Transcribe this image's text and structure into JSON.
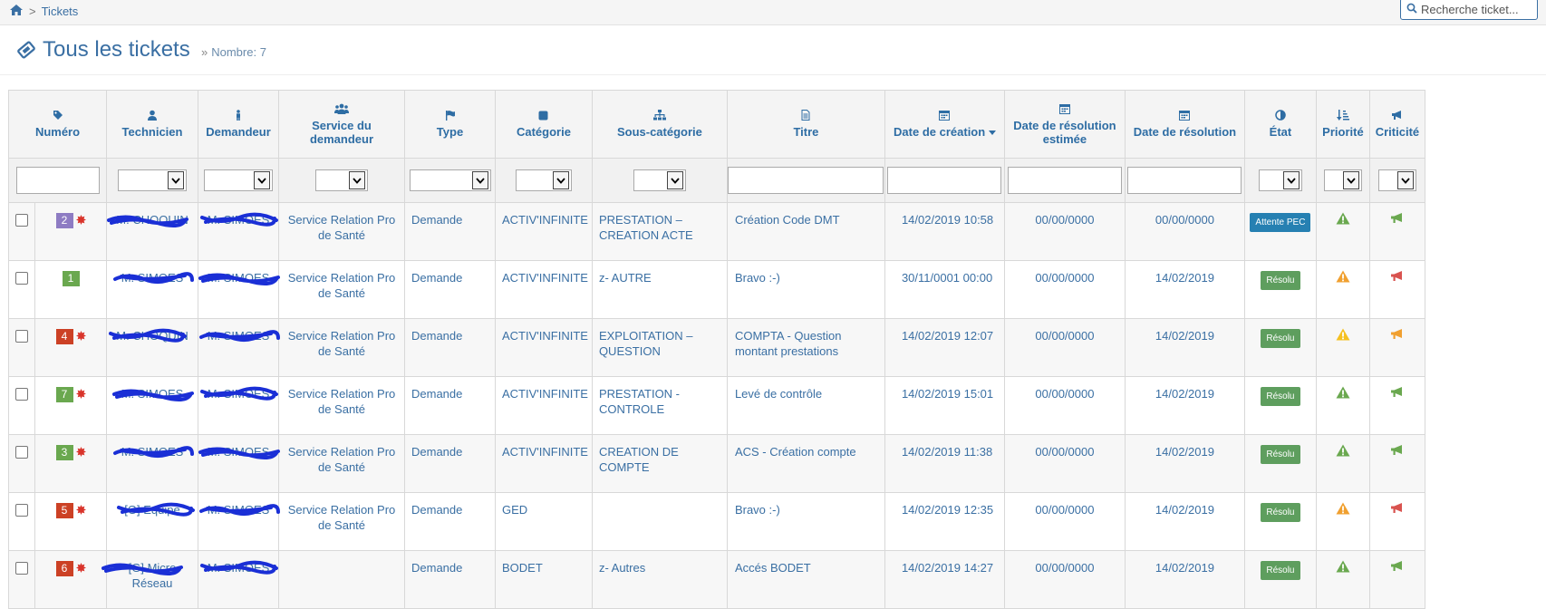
{
  "breadcrumb": {
    "home_icon": "home-icon",
    "separator": ">",
    "current": "Tickets"
  },
  "search": {
    "placeholder": "Recherche ticket...",
    "value": ""
  },
  "page": {
    "title": "Tous les tickets",
    "count_label": "Nombre: 7"
  },
  "columns": {
    "numero": "Numéro",
    "technicien": "Technicien",
    "demandeur": "Demandeur",
    "service": "Service du demandeur",
    "type": "Type",
    "categorie": "Catégorie",
    "sous_categorie": "Sous-catégorie",
    "titre": "Titre",
    "date_creation": "Date de création",
    "date_resolution_estimee": "Date de résolution estimée",
    "date_resolution": "Date de résolution",
    "etat": "État",
    "priorite": "Priorité",
    "criticite": "Criticité"
  },
  "colors": {
    "accent": "#3a6fa3",
    "purple": "#8e7cc3",
    "green": "#6aa84f",
    "red": "#cc4125",
    "warn_green": "#6aa84f",
    "warn_orange": "#f0a030",
    "warn_yellow": "#f5c020",
    "crit_red": "#d9534f",
    "crit_orange": "#f0a030"
  },
  "rows": [
    {
      "num": "2",
      "num_color": "purple",
      "star": true,
      "technicien": "M. CHOQUIN",
      "demandeur": "M. SIMOES",
      "service": "Service Relation Pro de Santé",
      "type": "Demande",
      "categorie": "ACTIV'INFINITE",
      "sous_categorie": "PRESTATION – CREATION ACTE",
      "titre": "Création Code DMT",
      "date_creation": "14/02/2019 10:58",
      "date_res_est": "00/00/0000",
      "date_res": "00/00/0000",
      "etat": "Attente PEC",
      "etat_kind": "wait",
      "priorite": "green",
      "criticite": "green"
    },
    {
      "num": "1",
      "num_color": "green",
      "star": false,
      "technicien": "M. SIMOES",
      "demandeur": "M. SIMOES",
      "service": "Service Relation Pro de Santé",
      "type": "Demande",
      "categorie": "ACTIV'INFINITE",
      "sous_categorie": "z- AUTRE",
      "titre": "Bravo :-)",
      "date_creation": "30/11/0001 00:00",
      "date_res_est": "00/00/0000",
      "date_res": "14/02/2019",
      "etat": "Résolu",
      "etat_kind": "ok",
      "priorite": "orange",
      "criticite": "red"
    },
    {
      "num": "4",
      "num_color": "red",
      "star": true,
      "technicien": "M. CHOQUIN",
      "demandeur": "M. SIMOES",
      "service": "Service Relation Pro de Santé",
      "type": "Demande",
      "categorie": "ACTIV'INFINITE",
      "sous_categorie": "EXPLOITATION – QUESTION",
      "titre": "COMPTA - Question montant prestations",
      "date_creation": "14/02/2019 12:07",
      "date_res_est": "00/00/0000",
      "date_res": "14/02/2019",
      "etat": "Résolu",
      "etat_kind": "ok",
      "priorite": "yellow",
      "criticite": "orange"
    },
    {
      "num": "7",
      "num_color": "green",
      "star": true,
      "technicien": "M. SIMOES",
      "demandeur": "M. SIMOES",
      "service": "Service Relation Pro de Santé",
      "type": "Demande",
      "categorie": "ACTIV'INFINITE",
      "sous_categorie": "PRESTATION - CONTROLE",
      "titre": "Levé de contrôle",
      "date_creation": "14/02/2019 15:01",
      "date_res_est": "00/00/0000",
      "date_res": "14/02/2019",
      "etat": "Résolu",
      "etat_kind": "ok",
      "priorite": "green",
      "criticite": "green"
    },
    {
      "num": "3",
      "num_color": "green",
      "star": true,
      "technicien": "M. SIMOES",
      "demandeur": "M. SIMOES",
      "service": "Service Relation Pro de Santé",
      "type": "Demande",
      "categorie": "ACTIV'INFINITE",
      "sous_categorie": "CREATION DE COMPTE",
      "titre": "ACS - Création compte",
      "date_creation": "14/02/2019 11:38",
      "date_res_est": "00/00/0000",
      "date_res": "14/02/2019",
      "etat": "Résolu",
      "etat_kind": "ok",
      "priorite": "green",
      "criticite": "green"
    },
    {
      "num": "5",
      "num_color": "red",
      "star": true,
      "technicien": "[G] Equipe",
      "demandeur": "M. SIMOES",
      "service": "Service Relation Pro de Santé",
      "type": "Demande",
      "categorie": "GED",
      "sous_categorie": "",
      "titre": "Bravo :-)",
      "date_creation": "14/02/2019 12:35",
      "date_res_est": "00/00/0000",
      "date_res": "14/02/2019",
      "etat": "Résolu",
      "etat_kind": "ok",
      "priorite": "orange",
      "criticite": "red"
    },
    {
      "num": "6",
      "num_color": "red",
      "star": true,
      "technicien": "[G] Micro Réseau",
      "demandeur": "M. SIMOES",
      "service": "",
      "type": "Demande",
      "categorie": "BODET",
      "sous_categorie": "z- Autres",
      "titre": "Accés BODET",
      "date_creation": "14/02/2019 14:27",
      "date_res_est": "00/00/0000",
      "date_res": "14/02/2019",
      "etat": "Résolu",
      "etat_kind": "ok",
      "priorite": "green",
      "criticite": "green"
    }
  ]
}
